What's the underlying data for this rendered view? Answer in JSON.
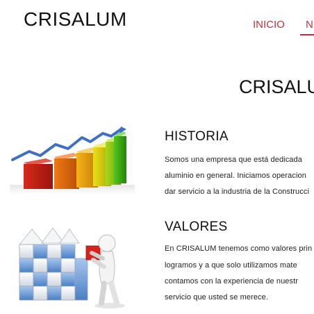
{
  "header": {
    "logo_text": "CRISALUM",
    "nav": [
      {
        "label": "INICIO"
      },
      {
        "label": "N"
      }
    ]
  },
  "main": {
    "company_title": "CRISALU",
    "sections": [
      {
        "heading": "HISTORIA",
        "lines": [
          "Somos una empresa que está dedicada",
          "aluminio en general. Iniciamos operacion",
          "dar servicio a la industria de la Construcci"
        ],
        "illustration_icon": "growth-bar-chart-icon"
      },
      {
        "heading": "VALORES",
        "lines": [
          "En CRISALUM tenemos como valores prin",
          "logramos y a que solo utilizamos mate",
          "contamos con la experiencia de nuestr",
          "servicio que usted se merece."
        ],
        "illustration_icon": "figure-building-blocks-icon"
      }
    ]
  },
  "colors": {
    "accent": "#c0303a",
    "text": "#222222"
  }
}
